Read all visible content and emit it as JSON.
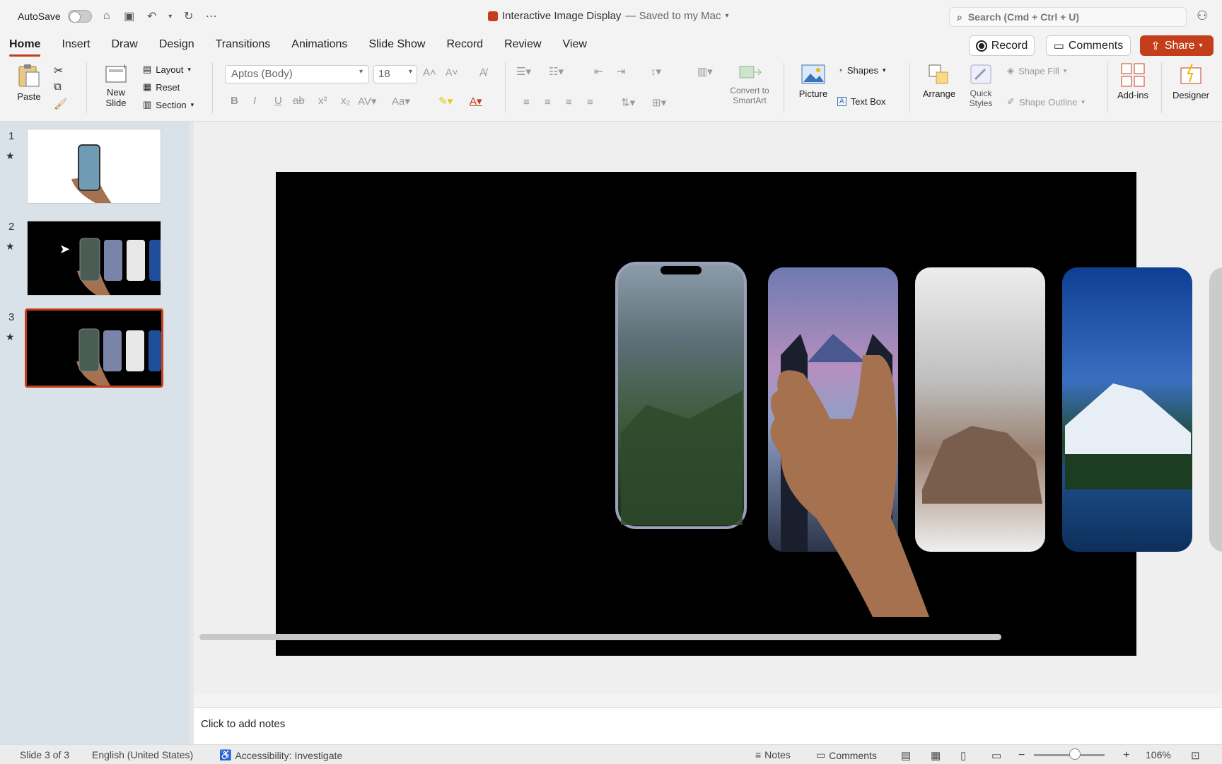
{
  "titlebar": {
    "autosave_label": "AutoSave",
    "doc_title": "Interactive Image Display",
    "saved_status": "— Saved to my Mac",
    "search_placeholder": "Search (Cmd + Ctrl + U)"
  },
  "menu": {
    "tabs": [
      "Home",
      "Insert",
      "Draw",
      "Design",
      "Transitions",
      "Animations",
      "Slide Show",
      "Record",
      "Review",
      "View"
    ],
    "active_tab": "Home",
    "record_label": "Record",
    "comments_label": "Comments",
    "share_label": "Share"
  },
  "ribbon": {
    "paste": "Paste",
    "new_slide_line1": "New",
    "new_slide_line2": "Slide",
    "layout": "Layout",
    "reset": "Reset",
    "section": "Section",
    "font_name": "Aptos (Body)",
    "font_size": "18",
    "convert_line1": "Convert to",
    "convert_line2": "SmartArt",
    "picture": "Picture",
    "shapes": "Shapes",
    "text_box": "Text Box",
    "arrange": "Arrange",
    "quick_styles_line1": "Quick",
    "quick_styles_line2": "Styles",
    "shape_fill": "Shape Fill",
    "shape_outline": "Shape Outline",
    "addins": "Add-ins",
    "designer": "Designer"
  },
  "thumbnails": [
    {
      "number": "1",
      "star": "★"
    },
    {
      "number": "2",
      "star": "★"
    },
    {
      "number": "3",
      "star": "★"
    }
  ],
  "notes_placeholder": "Click to add notes",
  "status": {
    "slide_info": "Slide 3 of 3",
    "language": "English (United States)",
    "accessibility": "Accessibility: Investigate",
    "notes": "Notes",
    "comments": "Comments",
    "zoom": "106%"
  },
  "colors": {
    "accent": "#c43e1c",
    "panel_bg": "#d9e2e8"
  }
}
